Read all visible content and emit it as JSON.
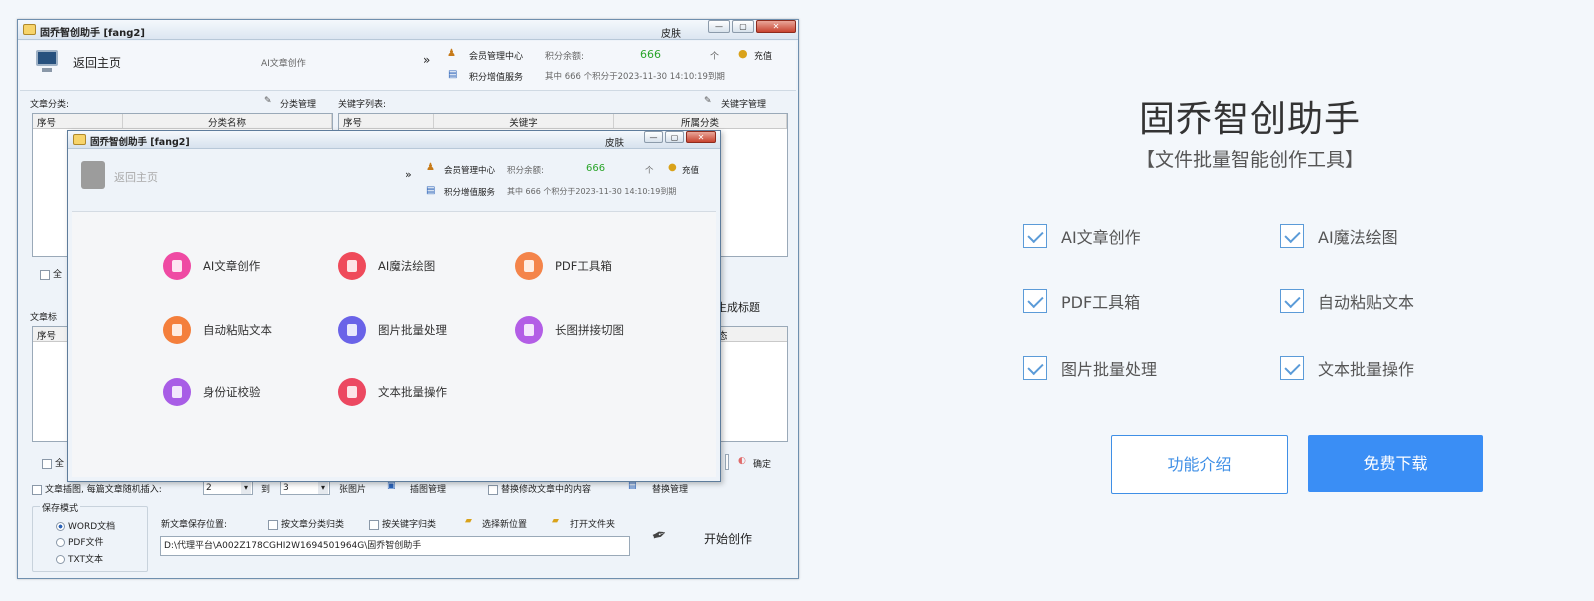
{
  "app": {
    "title": "固乔智创助手 [fang2]",
    "skin_label": "皮肤",
    "home_label": "返回主页",
    "ai_article_tab": "AI文章创作",
    "chevron": "»",
    "member_center": "会员管理中心",
    "points_balance_label": "积分余额:",
    "points_balance": "666",
    "points_unit": "个",
    "recharge": "充值",
    "points_service": "积分增值服务",
    "points_detail": "其中 666 个积分于2023-11-30 14:10:19到期",
    "category_section_label": "文章分类:",
    "category_manage": "分类管理",
    "keyword_section_label": "关键字列表:",
    "keyword_manage": "关键字管理",
    "category_columns": [
      "序号",
      "分类名称"
    ],
    "keyword_columns": [
      "序号",
      "关键字",
      "所属分类"
    ],
    "select_all_1": "全",
    "generate_title_partial": "生成标题",
    "article_title_label_partial": "文章标",
    "article_columns": [
      "序号"
    ],
    "article_status_partial": "态",
    "select_all_2": "全",
    "confirm": "确定",
    "insert_image_label": "文章插图, 每篇文章随机插入:",
    "insert_min": "2",
    "to": "到",
    "insert_max": "3",
    "images_unit": "张图片",
    "image_manage": "插图管理",
    "replace_content": "替换修改文章中的内容",
    "replace_manage": "替换管理",
    "save_mode_label": "保存模式",
    "save_modes": [
      "WORD文档",
      "PDF文件",
      "TXT文本"
    ],
    "save_location_label": "新文章保存位置:",
    "by_category": "按文章分类归类",
    "by_keyword": "按关键字归类",
    "choose_location": "选择新位置",
    "open_folder": "打开文件夹",
    "save_path": "D:\\代理平台\\A002Z178CGHI2W1694501964G\\固乔智创助手",
    "start_create": "开始创作"
  },
  "inner": {
    "title": "固乔智创助手 [fang2]",
    "skin_label": "皮肤",
    "home_label": "返回主页",
    "chevron": "»",
    "member_center": "会员管理中心",
    "points_balance_label": "积分余额:",
    "points_balance": "666",
    "points_unit": "个",
    "recharge": "充值",
    "points_service": "积分增值服务",
    "points_detail": "其中 666 个积分于2023-11-30 14:10:19到期",
    "features": [
      {
        "label": "AI文章创作",
        "color": "#ef4aa3"
      },
      {
        "label": "AI魔法绘图",
        "color": "#ef4a5a"
      },
      {
        "label": "PDF工具箱",
        "color": "#f4844a"
      },
      {
        "label": "自动粘贴文本",
        "color": "#f47f3c"
      },
      {
        "label": "图片批量处理",
        "color": "#6a63e8"
      },
      {
        "label": "长图拼接切图",
        "color": "#b35ee6"
      },
      {
        "label": "身份证校验",
        "color": "#a85de6"
      },
      {
        "label": "文本批量操作",
        "color": "#ec4861"
      }
    ]
  },
  "hero": {
    "title": "固乔智创助手",
    "subtitle": "【文件批量智能创作工具】",
    "features": [
      "AI文章创作",
      "AI魔法绘图",
      "PDF工具箱",
      "自动粘贴文本",
      "图片批量处理",
      "文本批量操作"
    ],
    "btn_intro": "功能介绍",
    "btn_download": "免费下载",
    "accent": "#3a8ef5"
  }
}
